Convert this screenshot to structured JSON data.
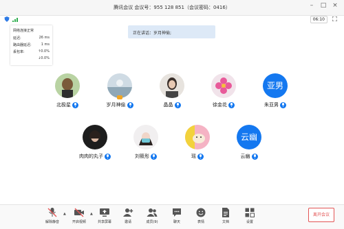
{
  "window": {
    "title": "腾讯会议 会议号：955 128 851（会议密码：0416）",
    "controls": [
      "minimize-icon",
      "maximize-icon",
      "close-icon"
    ]
  },
  "status": {
    "timer": "06:10"
  },
  "network": {
    "header": "网络连接正常",
    "rows": [
      {
        "label": "延迟:",
        "value": "26 ms"
      },
      {
        "label": "路由器延迟:",
        "value": "1 ms"
      },
      {
        "label": "丢包率:",
        "value": "↑0.0%"
      },
      {
        "label": "",
        "value": "↓0.0%"
      }
    ]
  },
  "speaking": {
    "text": "正在讲话：岁月神偷;"
  },
  "participants": [
    {
      "name": "北极星",
      "avatar": "photo"
    },
    {
      "name": "岁月神偷",
      "avatar": "photo",
      "host": true
    },
    {
      "name": "晶晶",
      "avatar": "photo"
    },
    {
      "name": "徐金花",
      "avatar": "photo"
    },
    {
      "name": "朱亚男",
      "avatar": "text",
      "initials": "亚男"
    },
    {
      "name": "肉肉的丸子",
      "avatar": "photo"
    },
    {
      "name": "刘筱彤",
      "avatar": "photo"
    },
    {
      "name": "瑶",
      "avatar": "photo"
    },
    {
      "name": "云幽",
      "avatar": "text",
      "initials": "云幽"
    }
  ],
  "toolbar": {
    "items": [
      {
        "label": "解除静音"
      },
      {
        "label": "开启视频"
      },
      {
        "label": "共享屏幕"
      },
      {
        "label": "邀请"
      },
      {
        "label": "成员(9)"
      },
      {
        "label": "聊天"
      },
      {
        "label": "表情"
      },
      {
        "label": "文档"
      },
      {
        "label": "设置"
      }
    ],
    "leave": "离开会议"
  },
  "colors": {
    "accent": "#1478f0",
    "leave": "#e35454",
    "speaking_bg": "#dde9f7"
  }
}
